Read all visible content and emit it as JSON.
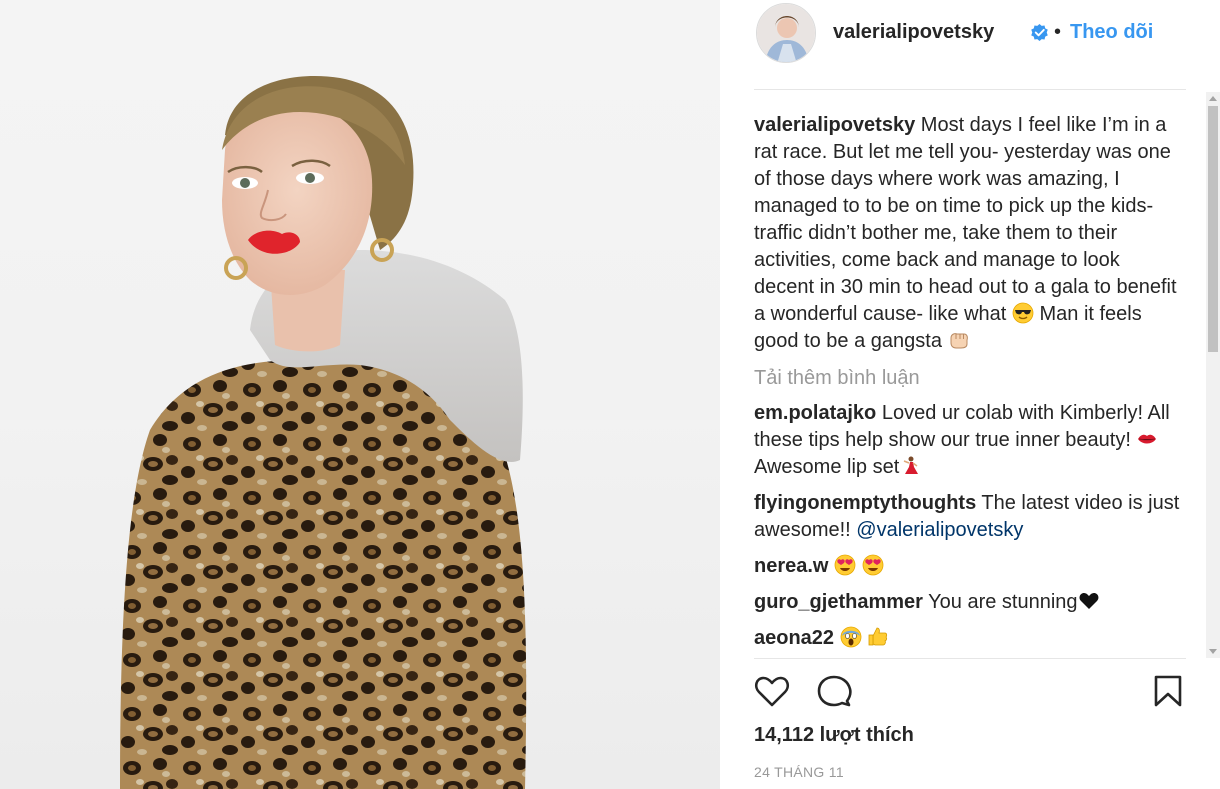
{
  "post": {
    "username": "valerialipovetsky",
    "separator": "•",
    "follow_label": "Theo dõi",
    "caption": {
      "username": "valerialipovetsky",
      "text": "Most days I feel like I’m in a rat race. But let me tell you- yesterday was one of those days where work was amazing, I managed to to be on time to pick up the kids- traffic didn’t bother me, take them to their activities, come back and manage to look decent in 30 min to head out to a gala to benefit a wonderful cause- like what",
      "text_end": "Man it feels good to be a gangsta",
      "emoji1": "sunglasses-face",
      "emoji2": "fist-bump"
    },
    "load_more": "Tải thêm bình luận",
    "comments": [
      {
        "user": "em.polatajko",
        "text": "Loved ur colab with Kimberly! All these tips help show our true inner beauty!",
        "text2": "Awesome lip set"
      },
      {
        "user": "flyingonemptythoughts",
        "text": "The latest video is just awesome!!",
        "mention": "@valerialipovetsky"
      },
      {
        "user": "nerea.w",
        "text": ""
      },
      {
        "user": "guro_gjethammer",
        "text": "You are stunning"
      },
      {
        "user": "aeona22",
        "text": ""
      }
    ],
    "likes_label": "14,112 lượt thích",
    "date": "24 THÁNG 11"
  },
  "icons": {
    "like": "heart-icon",
    "comment": "comment-icon",
    "save": "bookmark-icon",
    "verified": "verified-badge-icon"
  },
  "colors": {
    "accent": "#3897f0",
    "mention": "#003569",
    "muted": "#999999",
    "text": "#262626"
  }
}
